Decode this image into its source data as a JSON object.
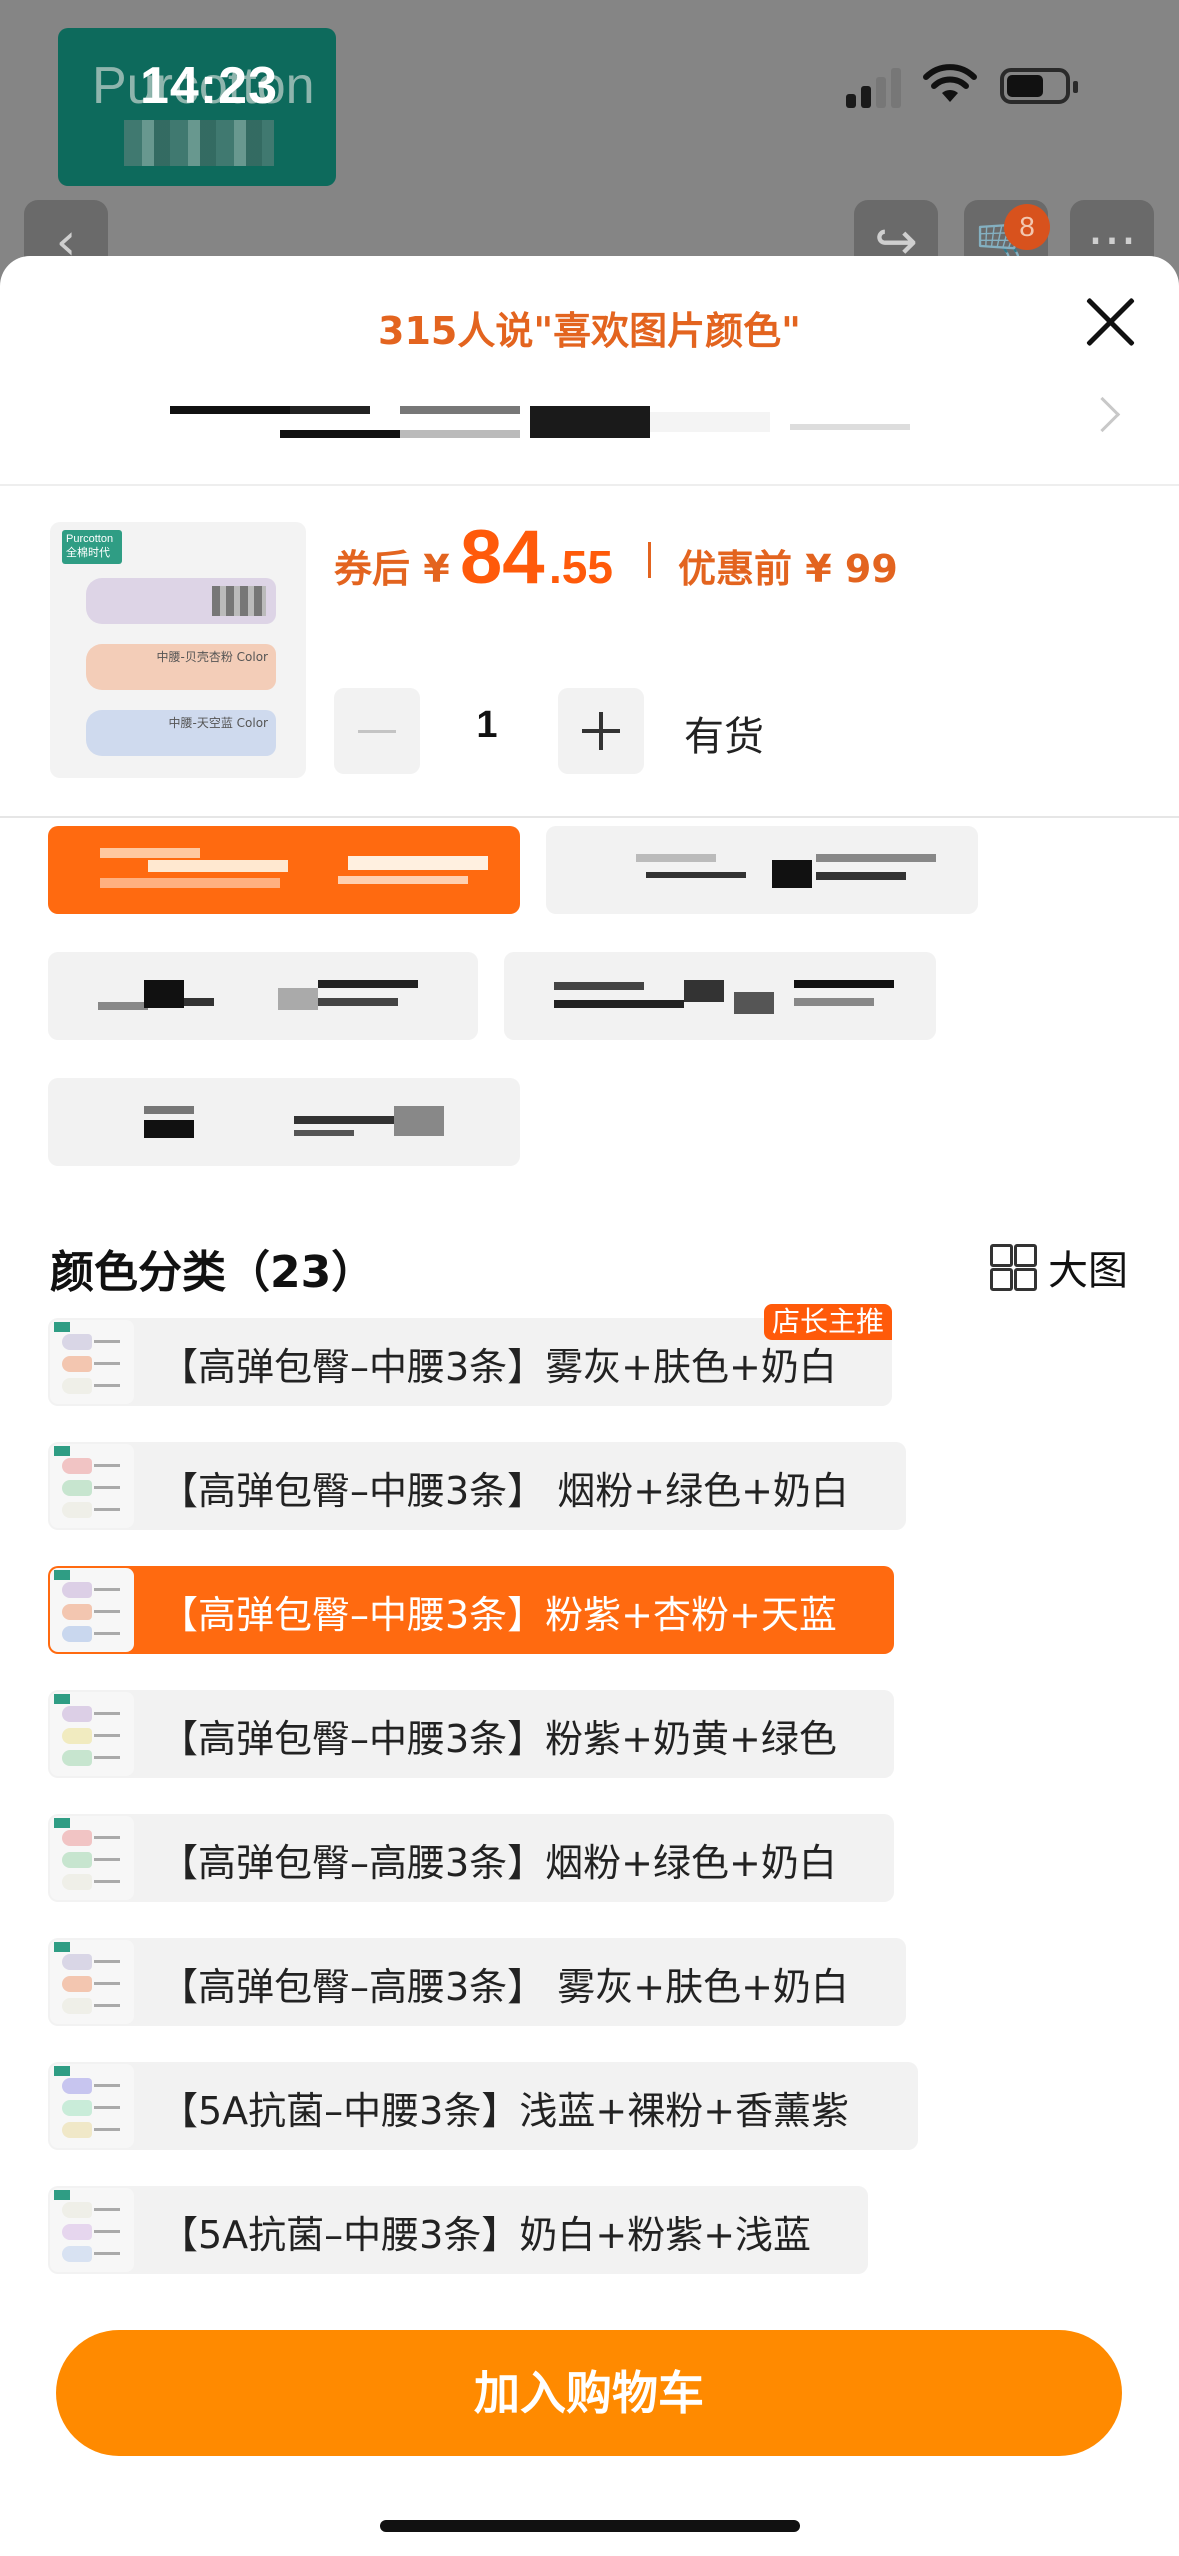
{
  "status_bar": {
    "time": "14:23"
  },
  "background_page": {
    "logo_text": "Purcotton",
    "cart_count": "8"
  },
  "sheet": {
    "title": "315人说\"喜欢图片颜色\"",
    "product": {
      "brand_tag": "Purcotton 全棉时代",
      "swatch_labels": [
        "中腰-贝壳杏粉 Color",
        "中腰-天空蓝 Color"
      ]
    },
    "price": {
      "after_label": "券后 ¥",
      "main_integer": "84",
      "main_decimal": ".55",
      "before_label": "优惠前 ¥ 99"
    },
    "quantity": {
      "value": "1"
    },
    "stock": "有货",
    "color_section": {
      "title": "颜色分类（23）",
      "big_view_label": "大图",
      "recommend_badge": "店长主推",
      "items": [
        {
          "label": "【高弹包臀–中腰3条】雾灰+肤色+奶白",
          "colors": [
            "#d9d6e6",
            "#f3c6b0",
            "#efefe8"
          ]
        },
        {
          "label": "【高弹包臀–中腰3条】 烟粉+绿色+奶白",
          "colors": [
            "#f1c4c4",
            "#c7e5cf",
            "#efefe8"
          ]
        },
        {
          "label": "【高弹包臀–中腰3条】粉紫+杏粉+天蓝",
          "colors": [
            "#dccfe6",
            "#f3c6b0",
            "#c9d7ee"
          ]
        },
        {
          "label": "【高弹包臀–中腰3条】粉紫+奶黄+绿色",
          "colors": [
            "#dccfe6",
            "#f1ebc0",
            "#c7e5cf"
          ]
        },
        {
          "label": "【高弹包臀–高腰3条】烟粉+绿色+奶白",
          "colors": [
            "#f1c4c4",
            "#c7e5cf",
            "#efefe8"
          ]
        },
        {
          "label": "【高弹包臀–高腰3条】 雾灰+肤色+奶白",
          "colors": [
            "#d9d6e6",
            "#f3c6b0",
            "#efefe8"
          ]
        },
        {
          "label": "【5A抗菌–中腰3条】浅蓝+裸粉+香薰紫",
          "colors": [
            "#c7c5ef",
            "#c9ecd9",
            "#f0e8c8"
          ]
        },
        {
          "label": "【5A抗菌–中腰3条】奶白+粉紫+浅蓝",
          "colors": [
            "#efefe8",
            "#e6d6ee",
            "#d8e2f2"
          ]
        }
      ]
    },
    "add_to_cart": "加入购物车"
  },
  "colors": {
    "accent_orange": "#ff6a10",
    "price_orange": "#ff5a0a",
    "cta_orange": "#ff8a00"
  }
}
